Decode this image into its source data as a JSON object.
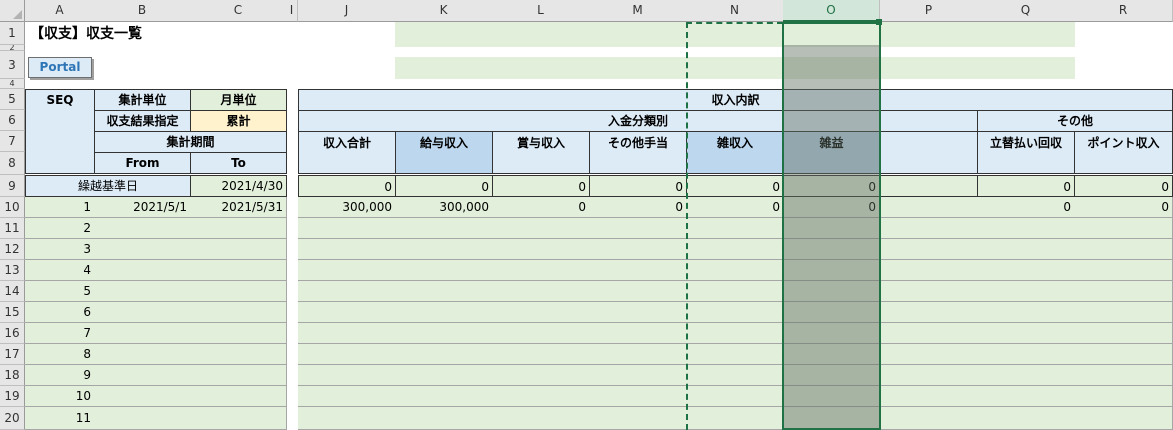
{
  "columns": [
    "A",
    "B",
    "C",
    "I",
    "J",
    "K",
    "L",
    "M",
    "N",
    "O",
    "P",
    "Q",
    "R"
  ],
  "selected_column": "O",
  "rows": [
    "1",
    "2",
    "3",
    "4",
    "5",
    "6",
    "7",
    "8",
    "9",
    "10",
    "11",
    "12",
    "13",
    "14",
    "15",
    "16",
    "17",
    "18",
    "19",
    "20"
  ],
  "title": "【収支】収支一覧",
  "portal_button": "Portal",
  "left_header": {
    "seq": "SEQ",
    "unit_label": "集計単位",
    "unit_value": "月単位",
    "result_label": "収支結果指定",
    "result_value": "累計",
    "period_label": "集計期間",
    "from": "From",
    "to": "To"
  },
  "carry_row": {
    "label": "繰越基準日",
    "date": "2021/4/30"
  },
  "row10": {
    "seq": "1",
    "from": "2021/5/1",
    "to": "2021/5/31"
  },
  "seq_numbers": [
    "2",
    "3",
    "4",
    "5",
    "6",
    "7",
    "8",
    "9",
    "10",
    "11"
  ],
  "right_header": {
    "income_breakdown": "収入内訳",
    "deposit_category": "入金分類別",
    "others": "その他",
    "cols": [
      "収入合計",
      "給与収入",
      "賞与収入",
      "その他手当",
      "雑収入",
      "雑益",
      "",
      "立替払い回収",
      "ポイント収入"
    ]
  },
  "row9_values": [
    "0",
    "0",
    "0",
    "0",
    "0",
    "0",
    "",
    "0",
    "0"
  ],
  "row10_values": [
    "300,000",
    "300,000",
    "0",
    "0",
    "0",
    "0",
    "",
    "0",
    "0"
  ],
  "colors": {
    "green_fill": "#e2efda",
    "blue_fill": "#ddebf7",
    "blue_dark": "#bdd7ee",
    "yellow_fill": "#fff2cc",
    "selection": "#217346"
  }
}
